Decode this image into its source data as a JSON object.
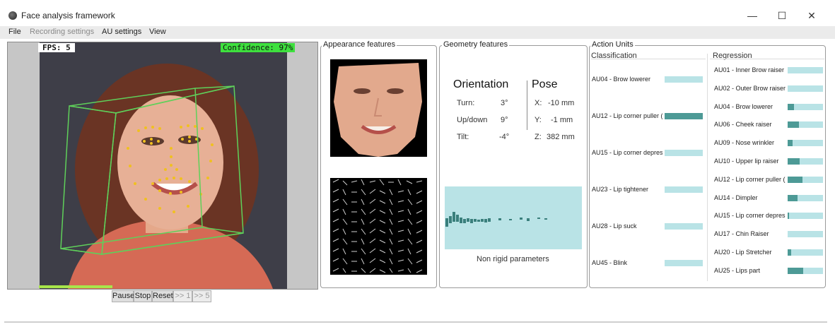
{
  "window": {
    "title": "Face analysis framework",
    "minimize": "—",
    "maximize": "☐",
    "close": "✕"
  },
  "menu": {
    "file": "File",
    "recording": "Recording settings",
    "au_settings": "AU settings",
    "view": "View"
  },
  "video": {
    "fps": "FPS: 5",
    "confidence": "Confidence: 97%",
    "progress": 0.3
  },
  "controls": {
    "pause": "Pause",
    "stop": "Stop",
    "reset": "Reset",
    "step1": ">> 1",
    "step5": ">> 5"
  },
  "appearance": {
    "legend": "Appearance features"
  },
  "geometry": {
    "legend": "Geometry features",
    "orientation_title": "Orientation",
    "pose_title": "Pose",
    "turn_label": "Turn:",
    "turn_value": "3°",
    "updown_label": "Up/down",
    "updown_value": "9°",
    "tilt_label": "Tilt:",
    "tilt_value": "-4°",
    "x_label": "X:",
    "x_value": "-10 mm",
    "y_label": "Y:",
    "y_value": "-1 mm",
    "z_label": "Z:",
    "z_value": "382 mm",
    "nrp_caption": "Non rigid parameters"
  },
  "action_units": {
    "legend": "Action Units",
    "classification_title": "Classification",
    "regression_title": "Regression",
    "classification": [
      {
        "label": "AU04 - Brow lowerer",
        "value": 0.0
      },
      {
        "label": "AU12 - Lip corner puller (",
        "value": 1.0
      },
      {
        "label": "AU15 - Lip corner depres",
        "value": 0.0
      },
      {
        "label": "AU23 - Lip tightener",
        "value": 0.0
      },
      {
        "label": "AU28 - Lip suck",
        "value": 0.0
      },
      {
        "label": "AU45 - Blink",
        "value": 0.0
      }
    ],
    "regression": [
      {
        "label": "AU01 - Inner Brow raiser",
        "value": 0.0
      },
      {
        "label": "AU02 - Outer Brow raiser",
        "value": 0.0
      },
      {
        "label": "AU04 - Brow lowerer",
        "value": 0.18
      },
      {
        "label": "AU06 - Cheek raiser",
        "value": 0.32
      },
      {
        "label": "AU09 - Nose wrinkler",
        "value": 0.14
      },
      {
        "label": "AU10 - Upper lip raiser",
        "value": 0.34
      },
      {
        "label": "AU12 - Lip corner puller (",
        "value": 0.42
      },
      {
        "label": "AU14 - Dimpler",
        "value": 0.28
      },
      {
        "label": "AU15 - Lip corner depres",
        "value": 0.03
      },
      {
        "label": "AU17 - Chin Raiser",
        "value": 0.0
      },
      {
        "label": "AU20 - Lip Stretcher",
        "value": 0.1
      },
      {
        "label": "AU25 - Lips part",
        "value": 0.44
      }
    ]
  }
}
